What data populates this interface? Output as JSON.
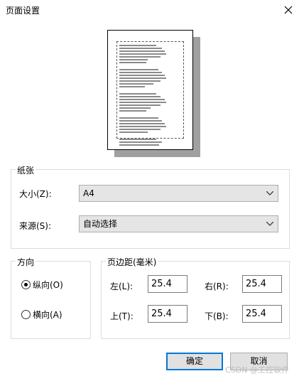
{
  "window": {
    "title": "页面设置"
  },
  "paper": {
    "group_label": "纸张",
    "size_label": "大小(Z):",
    "size_value": "A4",
    "source_label": "来源(S):",
    "source_value": "自动选择"
  },
  "orientation": {
    "group_label": "方向",
    "portrait_label": "纵向(O)",
    "landscape_label": "横向(A)",
    "selected": "portrait"
  },
  "margins": {
    "group_label": "页边距(毫米)",
    "left_label": "左(L):",
    "left_value": "25.4",
    "right_label": "右(R):",
    "right_value": "25.4",
    "top_label": "上(T):",
    "top_value": "25.4",
    "bottom_label": "下(B):",
    "bottom_value": "25.4"
  },
  "buttons": {
    "ok": "确定",
    "cancel": "取消"
  },
  "watermark": "CSDN @工控软件",
  "colors": {
    "accent": "#0078d7",
    "button_bg": "#e1e1e1",
    "select_bg": "#e5e5e5"
  },
  "icons": {
    "close": "close-icon",
    "dropdown": "chevron-down-icon"
  }
}
